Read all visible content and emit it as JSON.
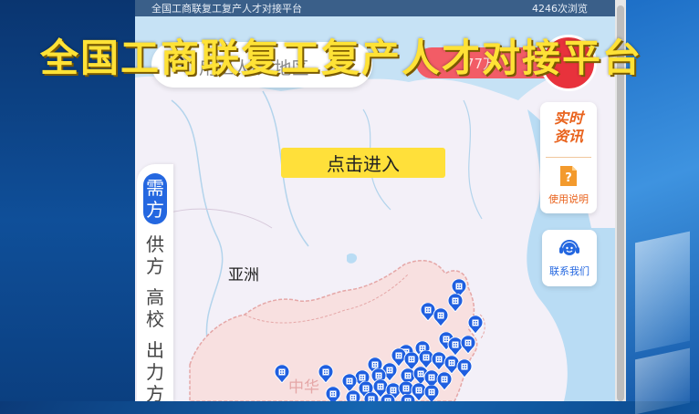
{
  "topbar": {
    "title": "全国工商联复工复产人才对接平台",
    "views": "4246次浏览"
  },
  "overlay_title": "全国工商联复工复产人才对接平台",
  "search": {
    "placeholder": "用工人/人地区"
  },
  "stat_pill": {
    "text": "77万"
  },
  "enter_button": {
    "label": "点击进入"
  },
  "side_tabs": [
    "需方",
    "供方",
    "高校",
    "出力方"
  ],
  "cards": {
    "news": {
      "title_line1": "实时",
      "title_line2": "资讯",
      "help_label": "使用说明"
    },
    "contact": {
      "label": "联系我们"
    }
  },
  "map": {
    "region_asia": "亚洲",
    "region_china": "中华"
  },
  "colors": {
    "accent_blue": "#2467e0",
    "overlay_yellow": "#ffe236",
    "pin_blue": "#1f5fe0",
    "pill_red": "#f25c66",
    "news_orange": "#e9621c"
  },
  "icons": [
    "search-icon",
    "help-doc-icon",
    "customer-service-icon",
    "building-pin-icon"
  ]
}
